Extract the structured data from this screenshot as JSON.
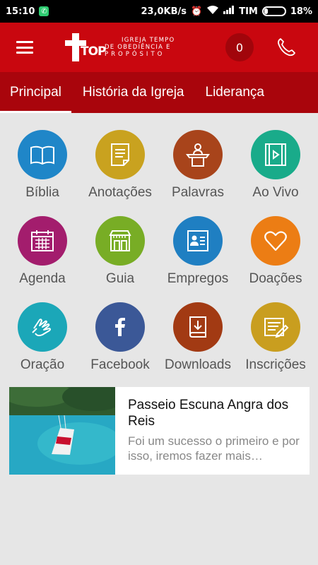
{
  "status": {
    "time": "15:10",
    "speed": "23,0KB/s",
    "carrier": "TIM",
    "battery": "18%"
  },
  "app": {
    "logo_top": "TOP",
    "logo_line1": "IGREJA TEMPO",
    "logo_line2": "DE OBEDIÊNCIA E",
    "logo_line3": "PROPÓSITO",
    "notification_count": "0"
  },
  "tabs": [
    {
      "label": "Principal",
      "active": true
    },
    {
      "label": "História da Igreja",
      "active": false
    },
    {
      "label": "Liderança",
      "active": false
    }
  ],
  "grid": [
    {
      "label": "Bíblia",
      "icon": "book-icon",
      "color": "#1f86c8"
    },
    {
      "label": "Anotações",
      "icon": "notes-icon",
      "color": "#c9a21f"
    },
    {
      "label": "Palavras",
      "icon": "pulpit-icon",
      "color": "#a8441b"
    },
    {
      "label": "Ao Vivo",
      "icon": "video-icon",
      "color": "#19ab8a"
    },
    {
      "label": "Agenda",
      "icon": "calendar-icon",
      "color": "#a31d6d"
    },
    {
      "label": "Guia",
      "icon": "storefront-icon",
      "color": "#78ad25"
    },
    {
      "label": "Empregos",
      "icon": "id-card-icon",
      "color": "#1f7fc2"
    },
    {
      "label": "Doações",
      "icon": "heart-icon",
      "color": "#ec7d14"
    },
    {
      "label": "Oração",
      "icon": "praying-hands-icon",
      "color": "#1ba7b8"
    },
    {
      "label": "Facebook",
      "icon": "facebook-icon",
      "color": "#3b5897"
    },
    {
      "label": "Downloads",
      "icon": "download-book-icon",
      "color": "#a23a13"
    },
    {
      "label": "Inscrições",
      "icon": "form-edit-icon",
      "color": "#c99e1f"
    }
  ],
  "card": {
    "title": "Passeio Escuna Angra dos Reis",
    "description": "Foi um sucesso o primeiro e por isso, iremos fazer mais…"
  }
}
